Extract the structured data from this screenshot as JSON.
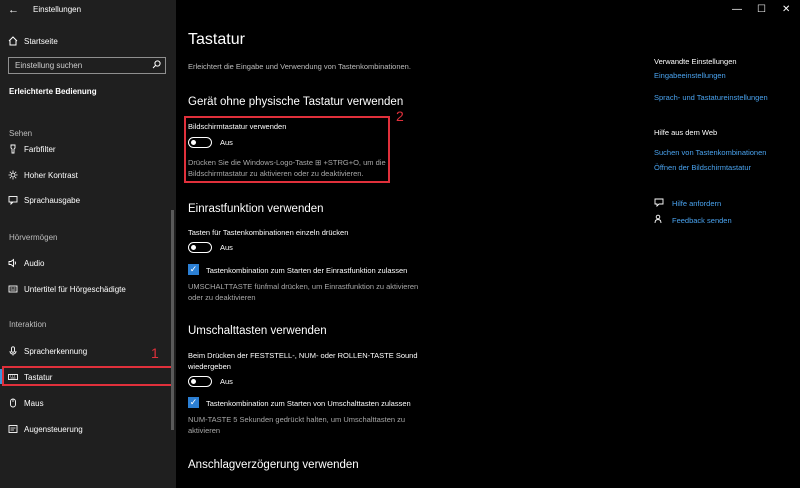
{
  "window": {
    "title": "Einstellungen",
    "back_glyph": "←",
    "minimize_glyph": "—",
    "maximize_glyph": "☐",
    "close_glyph": "✕"
  },
  "sidebar": {
    "home_label": "Startseite",
    "search_placeholder": "Einstellung suchen",
    "category_title": "Erleichterte Bedienung",
    "sections": {
      "sehen": "Sehen",
      "hoervermoegen": "Hörvermögen",
      "interaktion": "Interaktion"
    },
    "items": [
      {
        "label": "Farbfilter",
        "icon": "color-filter-icon"
      },
      {
        "label": "Hoher Kontrast",
        "icon": "contrast-icon"
      },
      {
        "label": "Sprachausgabe",
        "icon": "narrator-icon"
      },
      {
        "label": "Audio",
        "icon": "speaker-icon"
      },
      {
        "label": "Untertitel für Hörgeschädigte",
        "icon": "captions-icon"
      },
      {
        "label": "Spracherkennung",
        "icon": "microphone-icon"
      },
      {
        "label": "Tastatur",
        "icon": "keyboard-icon"
      },
      {
        "label": "Maus",
        "icon": "mouse-icon"
      },
      {
        "label": "Augensteuerung",
        "icon": "eye-control-icon"
      }
    ],
    "callout_number": "1",
    "accent_color": "#3a96dd",
    "highlight_color": "#e0303b"
  },
  "main": {
    "page_title": "Tastatur",
    "page_subtitle": "Erleichtert die Eingabe und Verwendung von Tastenkombinationen.",
    "section1": {
      "title": "Gerät ohne physische Tastatur verwenden",
      "setting_label": "Bildschirmtastatur verwenden",
      "toggle_state": "Aus",
      "description_line1": "Drücken Sie die Windows-Logo-Taste ⊞ +STRG+O, um die",
      "description_line2": "Bildschirmtastatur zu aktivieren oder zu deaktivieren.",
      "callout_number": "2"
    },
    "section2": {
      "title": "Einrastfunktion verwenden",
      "setting_label": "Tasten für Tastenkombinationen einzeln drücken",
      "toggle_state": "Aus",
      "checkbox_label": "Tastenkombination zum Starten der Einrastfunktion zulassen",
      "checkbox_checked": true,
      "description_line1": "UMSCHALTTASTE fünfmal drücken, um Einrastfunktion zu aktivieren",
      "description_line2": "oder zu deaktivieren"
    },
    "section3": {
      "title": "Umschalttasten verwenden",
      "setting_label_line1": "Beim Drücken der FESTSTELL-, NUM- oder ROLLEN-TASTE Sound",
      "setting_label_line2": "wiedergeben",
      "toggle_state": "Aus",
      "checkbox_label": "Tastenkombination zum Starten von Umschalttasten zulassen",
      "checkbox_checked": true,
      "description_line1": "NUM-TASTE 5 Sekunden gedrückt halten, um Umschalttasten zu",
      "description_line2": "aktivieren"
    },
    "section4": {
      "title": "Anschlagverzögerung verwenden"
    }
  },
  "related": {
    "heading": "Verwandte Einstellungen",
    "links": [
      "Eingabeeinstellungen",
      "Sprach- und Tastatureinstellungen"
    ],
    "help_heading": "Hilfe aus dem Web",
    "help_links": [
      "Suchen von Tastenkombinationen",
      "Öffnen der Bildschirmtastatur"
    ],
    "support_links": [
      {
        "label": "Hilfe anfordern",
        "icon": "help-icon"
      },
      {
        "label": "Feedback senden",
        "icon": "feedback-icon"
      }
    ],
    "link_color": "#4aa3ef"
  }
}
